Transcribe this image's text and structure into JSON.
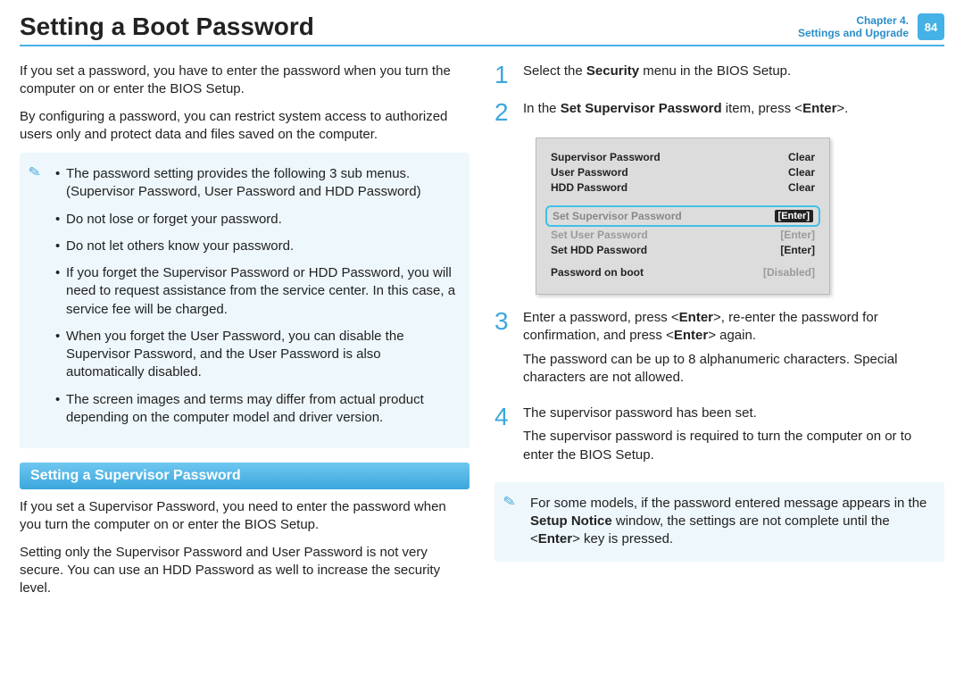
{
  "header": {
    "title": "Setting a Boot Password",
    "chapter_line1": "Chapter 4.",
    "chapter_line2": "Settings and Upgrade",
    "page_num": "84"
  },
  "left": {
    "intro1": "If you set a password, you have to enter the password when you turn the computer on or enter the BIOS Setup.",
    "intro2": "By configuring a password, you can restrict system access to authorized users only and protect data and files saved on the computer.",
    "notes": [
      "The password setting provides the following 3 sub menus. (Supervisor Password, User Password and HDD Password)",
      "Do not lose or forget your password.",
      "Do not let others know your password.",
      "If you forget the Supervisor Password or HDD Password, you will need to request assistance from the service center. In this case, a service fee will be charged.",
      "When you forget the User Password, you can disable the Supervisor Password, and the User Password is also automatically disabled.",
      "The screen images and terms may differ from actual product depending on the computer model and driver version."
    ],
    "section_heading": "Setting a Supervisor Password",
    "sup1": "If you set a Supervisor Password, you need to enter the password when you turn the computer on or enter the BIOS Setup.",
    "sup2": "Setting only the Supervisor Password and User Password is not very secure. You can use an HDD Password as well to increase the security level."
  },
  "right": {
    "step1_num": "1",
    "step1_pre": "Select the ",
    "step1_bold": "Security",
    "step1_post": " menu in the BIOS Setup.",
    "step2_num": "2",
    "step2_pre": "In the ",
    "step2_bold": "Set Supervisor Password",
    "step2_mid": " item, press <",
    "step2_enter": "Enter",
    "step2_post": ">.",
    "bios": {
      "r1_l": "Supervisor Password",
      "r1_v": "Clear",
      "r2_l": "User Password",
      "r2_v": "Clear",
      "r3_l": "HDD Password",
      "r3_v": "Clear",
      "r4_l": "Set Supervisor Password",
      "r4_v": "[Enter]",
      "r5_l": "Set User Password",
      "r5_v": "[Enter]",
      "r6_l": "Set HDD Password",
      "r6_v": "[Enter]",
      "r7_l": "Password on boot",
      "r7_v": "[Disabled]"
    },
    "step3_num": "3",
    "step3_a_pre": "Enter a password, press <",
    "step3_a_b1": "Enter",
    "step3_a_mid": ">, re-enter the password for confirmation, and press <",
    "step3_a_b2": "Enter",
    "step3_a_post": "> again.",
    "step3_b": "The password can be up to 8 alphanumeric characters. Special characters are not allowed.",
    "step4_num": "4",
    "step4_a": "The supervisor password has been set.",
    "step4_b": "The supervisor password is required to turn the computer on or to enter the BIOS Setup.",
    "bottom_note_pre": "For some models, if the password entered message appears in the ",
    "bottom_note_bold": "Setup Notice",
    "bottom_note_mid": " window, the settings are not complete until the <",
    "bottom_note_enter": "Enter",
    "bottom_note_post": "> key is pressed."
  }
}
